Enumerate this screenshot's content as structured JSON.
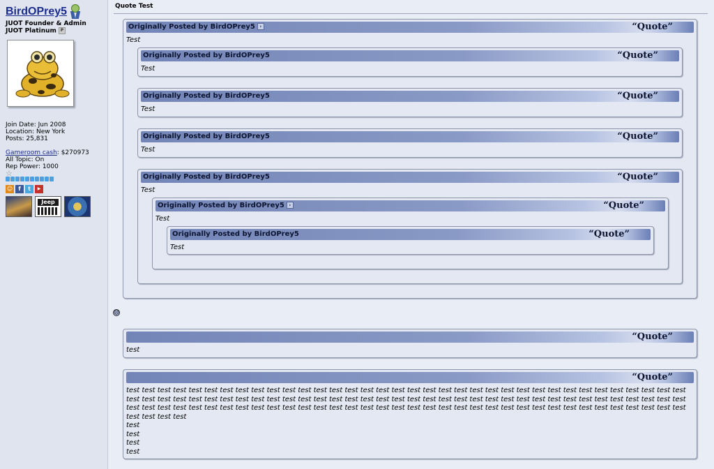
{
  "user": {
    "name": "BirdOPrey5",
    "title1": "JUOT Founder & Admin",
    "title2": "JUOT Platinum",
    "premium_badge": "P",
    "join_date": "Join Date: Jun 2008",
    "location": "Location: New York",
    "posts": "Posts: 25,831",
    "gameroom_label": "Gameroom cash",
    "gameroom_value": ": $270973",
    "all_topic": "All Topic: On",
    "rep_power": "Rep Power: 1000",
    "rep_pips": 10,
    "social_icons": [
      "person-icon",
      "facebook-icon",
      "twitter-icon",
      "youtube-icon"
    ],
    "thumb_jeep": "Jeep"
  },
  "post": {
    "title": "Quote Test"
  },
  "quotes": {
    "q1": {
      "by": "Originally Posted by BirdOPrey5",
      "label": "“Quote”",
      "text": "Test"
    },
    "q2": {
      "by": "Originally Posted by BirdOPrey5",
      "label": "“Quote”",
      "text": "Test"
    },
    "q3": {
      "by": "Originally Posted by BirdOPrey5",
      "label": "“Quote”",
      "text": "Test"
    },
    "q4": {
      "by": "Originally Posted by BirdOPrey5",
      "label": "“Quote”",
      "text": "Test"
    },
    "q5": {
      "by": "Originally Posted by BirdOPrey5",
      "label": "“Quote”",
      "text": "Test"
    },
    "q6": {
      "by": "Originally Posted by BirdOPrey5",
      "label": "“Quote”",
      "text": "Test"
    },
    "q7": {
      "by": "Originally Posted by BirdOPrey5",
      "label": "“Quote”",
      "text": "Test"
    },
    "q8": {
      "label": "“Quote”",
      "text": "test"
    },
    "q9": {
      "label": "“Quote”",
      "text": "test test test test test test test test test test test test test test test test test test test test test test test test test test test test test test test test test test test test test test test test test test test test test test test test test test test test test test test test test test test test test test test test test test test test test test test test test test test test test test test test test test test test test test test test test test test test test test test test test test test test test test test test test test test test test test test test\ntest\ntest\ntest\ntest"
    }
  },
  "smiley_icon": "sad-face-icon",
  "colors": {
    "quote_bar": "#7385b7",
    "quote_box": "#e4e8f2",
    "username": "#1b2c8c",
    "rep": "#4f9fe0"
  }
}
